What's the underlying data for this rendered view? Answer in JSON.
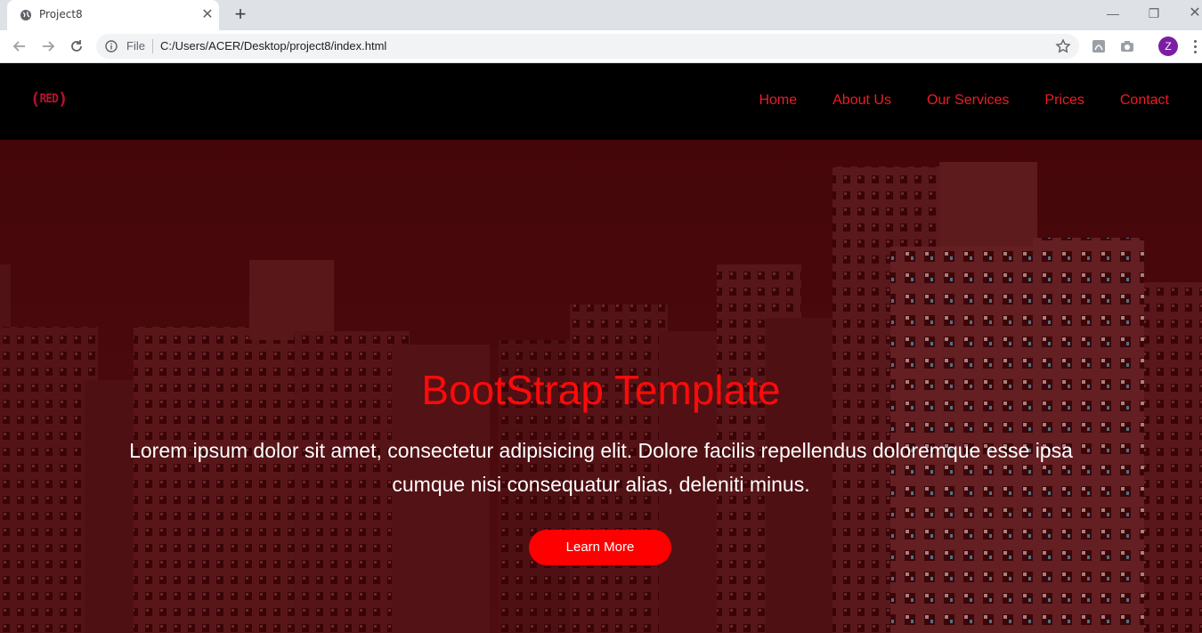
{
  "browser": {
    "tab_title": "Project8",
    "new_tab_symbol": "+",
    "address": {
      "scheme_label": "File",
      "url": "C:/Users/ACER/Desktop/project8/index.html"
    },
    "profile_initial": "Z",
    "icons": [
      "globe-icon",
      "close-icon",
      "back-icon",
      "forward-icon",
      "reload-icon",
      "info-icon",
      "star-icon",
      "pdf-extension-icon",
      "camera-extension-icon",
      "menu-icon",
      "minimize-icon",
      "maximize-icon",
      "window-close-icon"
    ]
  },
  "navbar": {
    "logo": {
      "open": "(",
      "text": "RED",
      "close": ")"
    },
    "links": [
      "Home",
      "About Us",
      "Our Services",
      "Prices",
      "Contact"
    ]
  },
  "hero": {
    "title": "BootStrap Template",
    "text": "Lorem ipsum dolor sit amet, consectetur adipisicing elit. Dolore facilis repellendus doloremque esse ipsa cumque nisi consequatur alias, deleniti minus.",
    "button": "Learn More"
  },
  "colors": {
    "accent": "#ff0000",
    "nav_link": "#ee1c25",
    "logo": "#b3122a",
    "navbar_bg": "#000000",
    "avatar": "#7b1fa2"
  }
}
